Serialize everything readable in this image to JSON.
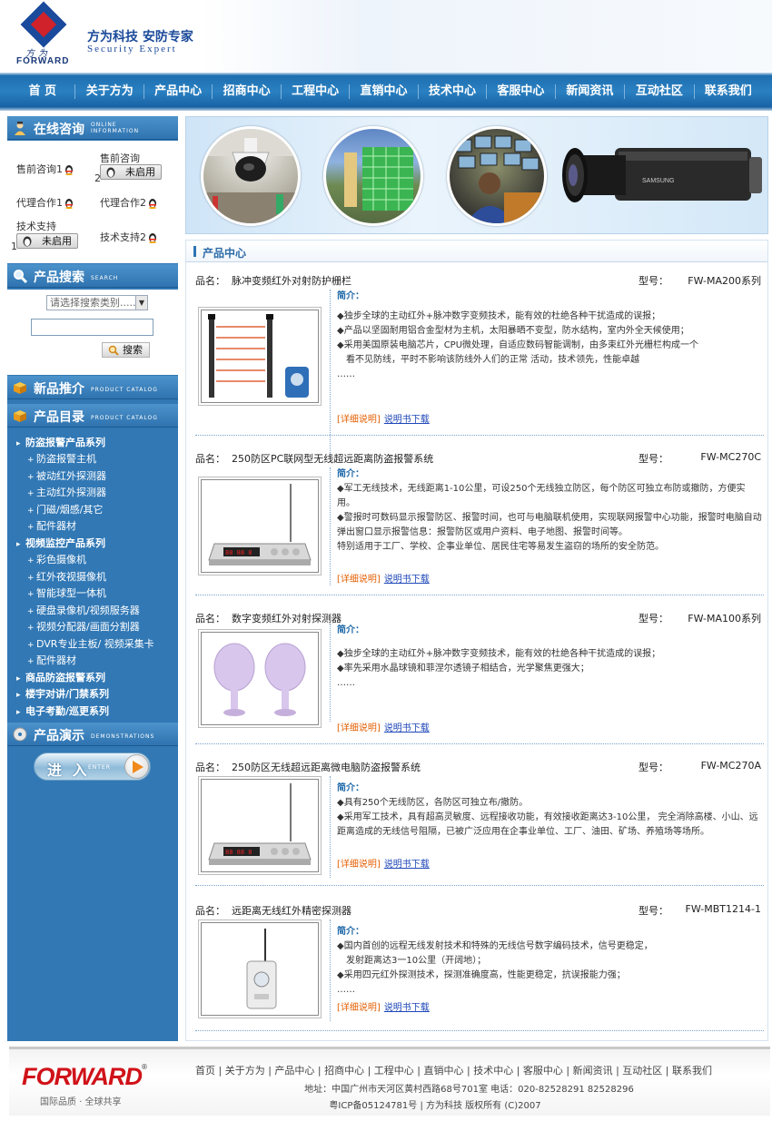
{
  "header": {
    "logo_cn": "方为",
    "logo_en": "FORWARD",
    "slogan_cn": "方为科技 安防专家",
    "slogan_en": "Security Expert"
  },
  "nav": [
    "首 页",
    "关于方为",
    "产品中心",
    "招商中心",
    "工程中心",
    "直销中心",
    "技术中心",
    "客服中心",
    "新闻资讯",
    "互动社区",
    "联系我们"
  ],
  "sidebar": {
    "consult": {
      "title": "在线咨询",
      "title_en": "ONLINE INFORMATION",
      "presale1": "售前咨询1",
      "presale2_label": "售前咨询",
      "presale2_num": "2",
      "off_label": "未启用",
      "agent1": "代理合作1",
      "agent2": "代理合作2",
      "support1_label": "技术支持",
      "support1_num": "1",
      "support2": "技术支持2"
    },
    "search": {
      "title": "产品搜索",
      "title_en": "SEARCH",
      "select_placeholder": "请选择搜索类别......",
      "button": "搜索"
    },
    "new_products": {
      "title": "新品推介",
      "title_en": "PRODUCT CATALOG"
    },
    "catalog": {
      "title": "产品目录",
      "title_en": "PRODUCT CATALOG",
      "items": [
        {
          "level": 1,
          "label": "防盗报警产品系列"
        },
        {
          "level": 2,
          "label": "防盗报警主机"
        },
        {
          "level": 2,
          "label": "被动红外探测器"
        },
        {
          "level": 2,
          "label": "主动红外探测器"
        },
        {
          "level": 2,
          "label": "门磁/烟感/其它"
        },
        {
          "level": 2,
          "label": "配件器材"
        },
        {
          "level": 1,
          "label": "视频监控产品系列"
        },
        {
          "level": 2,
          "label": "彩色摄像机"
        },
        {
          "level": 2,
          "label": "红外夜视摄像机"
        },
        {
          "level": 2,
          "label": "智能球型一体机"
        },
        {
          "level": 2,
          "label": "硬盘录像机/视频服务器"
        },
        {
          "level": 2,
          "label": "视频分配器/画面分割器"
        },
        {
          "level": 2,
          "label": "DVR专业主板/ 视频采集卡"
        },
        {
          "level": 2,
          "label": "配件器材"
        },
        {
          "level": 1,
          "label": "商品防盗报警系列"
        },
        {
          "level": 1,
          "label": "楼宇对讲/门禁系列"
        },
        {
          "level": 1,
          "label": "电子考勤/巡更系列"
        }
      ]
    },
    "demo": {
      "title": "产品演示",
      "title_en": "DEMONSTRATIONS",
      "enter_cn": "进 入",
      "enter_en": "ENTER"
    }
  },
  "content": {
    "title": "产品中心",
    "name_label": "品名：",
    "model_label": "型号：",
    "intro_label": "简介：",
    "detail_link": "[详细说明]",
    "manual_link": "说明书下载",
    "products": [
      {
        "name": "脉冲变频红外对射防护栅栏",
        "model": "FW-MA200系列",
        "desc": [
          "◆独步全球的主动红外+脉冲数字变频技术，能有效的杜绝各种干扰造成的误报；",
          "◆产品以坚固耐用铝合金型材为主机，太阳暴晒不变型，防水结构，室内外全天候使用；",
          "◆采用美国原装电脑芯片，CPU微处理，自适应数码智能调制，由多束红外光栅栏构成一个",
          "　看不见防线，平时不影响该防线外人们的正常 活动，技术领先，性能卓越",
          "……"
        ]
      },
      {
        "name": "250防区PC联网型无线超远距离防盗报警系统",
        "model": "FW-MC270C",
        "desc": [
          "◆军工无线技术，无线距离1-10公里，可设250个无线独立防区，每个防区可独立布防或撤防，方便实用。",
          "◆警报时可数码显示报警防区、报警时间，也可与电脑联机使用，实现联网报警中心功能，报警时电脑自动弹出窗口显示报警信息：报警防区或用户资料、电子地图、报警时间等。",
          "特别适用于工厂、学校、企事业单位、居民住宅等易发生盗窃的场所的安全防范。"
        ]
      },
      {
        "name": "数字变频红外对射探测器",
        "model": "FW-MA100系列",
        "desc": [
          "◆独步全球的主动红外+脉冲数字变频技术，能有效的杜绝各种干扰造成的误报；",
          "◆率先采用水晶球镜和菲涅尔透镜子相结合，光学聚焦更强大；",
          "……"
        ]
      },
      {
        "name": "250防区无线超远距离微电脑防盗报警系统",
        "model": "FW-MC270A",
        "desc": [
          "◆具有250个无线防区，各防区可独立布/撤防。",
          "◆采用军工技术，具有超高灵敏度、远程接收功能，有效接收距离达3-10公里， 完全消除高楼、小山、远距离造成的无线信号阻隔，已被广泛应用在企事业单位、工厂、油田、矿场、养殖场等场所。"
        ]
      },
      {
        "name": "远距离无线红外精密探测器",
        "model": "FW-MBT1214-1",
        "desc": [
          "◆国内首创的远程无线发射技术和特殊的无线信号数字编码技术，信号更稳定，",
          "　发射距离达3一10公里（开阔地）；",
          "◆采用四元红外探测技术，探测准确度高，性能更稳定，抗误报能力强；",
          "……"
        ]
      }
    ]
  },
  "footer": {
    "logo": "FORWARD",
    "tagline": "国际品质 · 全球共享",
    "nav": "首页 | 关于方为 | 产品中心 | 招商中心 | 工程中心 | 直销中心 | 技术中心 | 客服中心 | 新闻资讯 | 互动社区 | 联系我们",
    "address": "地址：中国广州市天河区黄村西路68号701室 电话：020-82528291 82528296",
    "copyright": "粤ICP备05124781号 | 方为科技 版权所有 (C)2007"
  }
}
